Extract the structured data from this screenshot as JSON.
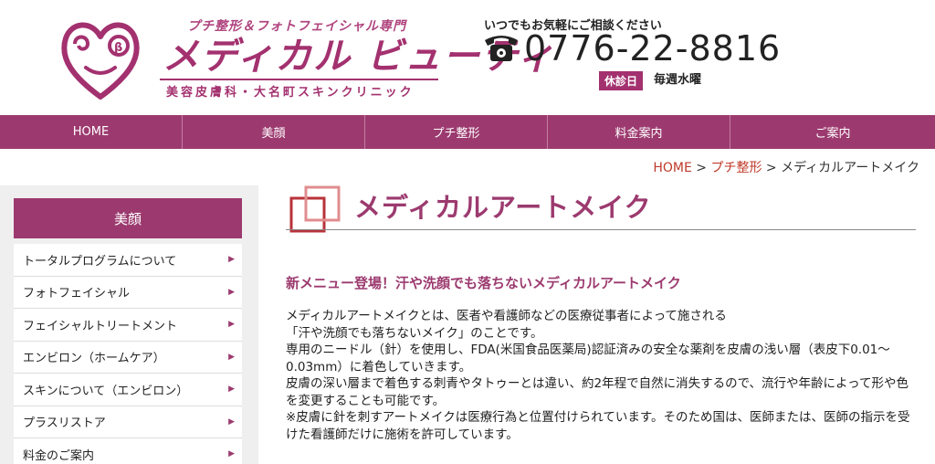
{
  "header": {
    "tagline": "プチ整形＆フォトフェイシャル専門",
    "brand": "メディカル ビューティ",
    "clinic": "美容皮膚科・大名町スキンクリニック",
    "contact_prompt": "いつでもお気軽にご相談ください",
    "phone": "0776-22-8816",
    "closed_label": "休診日",
    "closed_value": "毎週水曜"
  },
  "nav": [
    {
      "label": "HOME"
    },
    {
      "label": "美顔"
    },
    {
      "label": "プチ整形"
    },
    {
      "label": "料金案内"
    },
    {
      "label": "ご案内"
    }
  ],
  "breadcrumb": {
    "home": "HOME",
    "sep1": " > ",
    "parent": "プチ整形",
    "sep2": " > ",
    "current": "メディカルアートメイク"
  },
  "sidebar": {
    "heading": "美顔",
    "items": [
      {
        "label": "トータルプログラムについて"
      },
      {
        "label": "フォトフェイシャル"
      },
      {
        "label": "フェイシャルトリートメント"
      },
      {
        "label": "エンビロン（ホームケア）"
      },
      {
        "label": "スキンについて（エンビロン）"
      },
      {
        "label": "プラスリストア"
      },
      {
        "label": "料金のご案内"
      }
    ],
    "arrow": "▶"
  },
  "main": {
    "title": "メディカルアートメイク",
    "subhead": "新メニュー登場！汗や洗顔でも落ちないメディカルアートメイク",
    "paragraphs": [
      "メディカルアートメイクとは、医者や看護師などの医療従事者によって施される",
      "「汗や洗顔でも落ちないメイク」のことです。",
      "専用のニードル（針）を使用し、FDA(米国食品医薬局)認証済みの安全な薬剤を皮膚の浅い層（表皮下0.01～0.03mm）に着色していきます。",
      "皮膚の深い層まで着色する刺青やタトゥーとは違い、約2年程で自然に消失するので、流行や年齢によって形や色を変更することも可能です。",
      "※皮膚に針を刺すアートメイクは医療行為と位置付けられています。そのため国は、医師または、医師の指示を受けた看護師だけに施術を許可しています。"
    ]
  },
  "colors": {
    "brand": "#9c3a6f",
    "link": "#c03a2b",
    "sidebar_bg": "#efefef"
  }
}
